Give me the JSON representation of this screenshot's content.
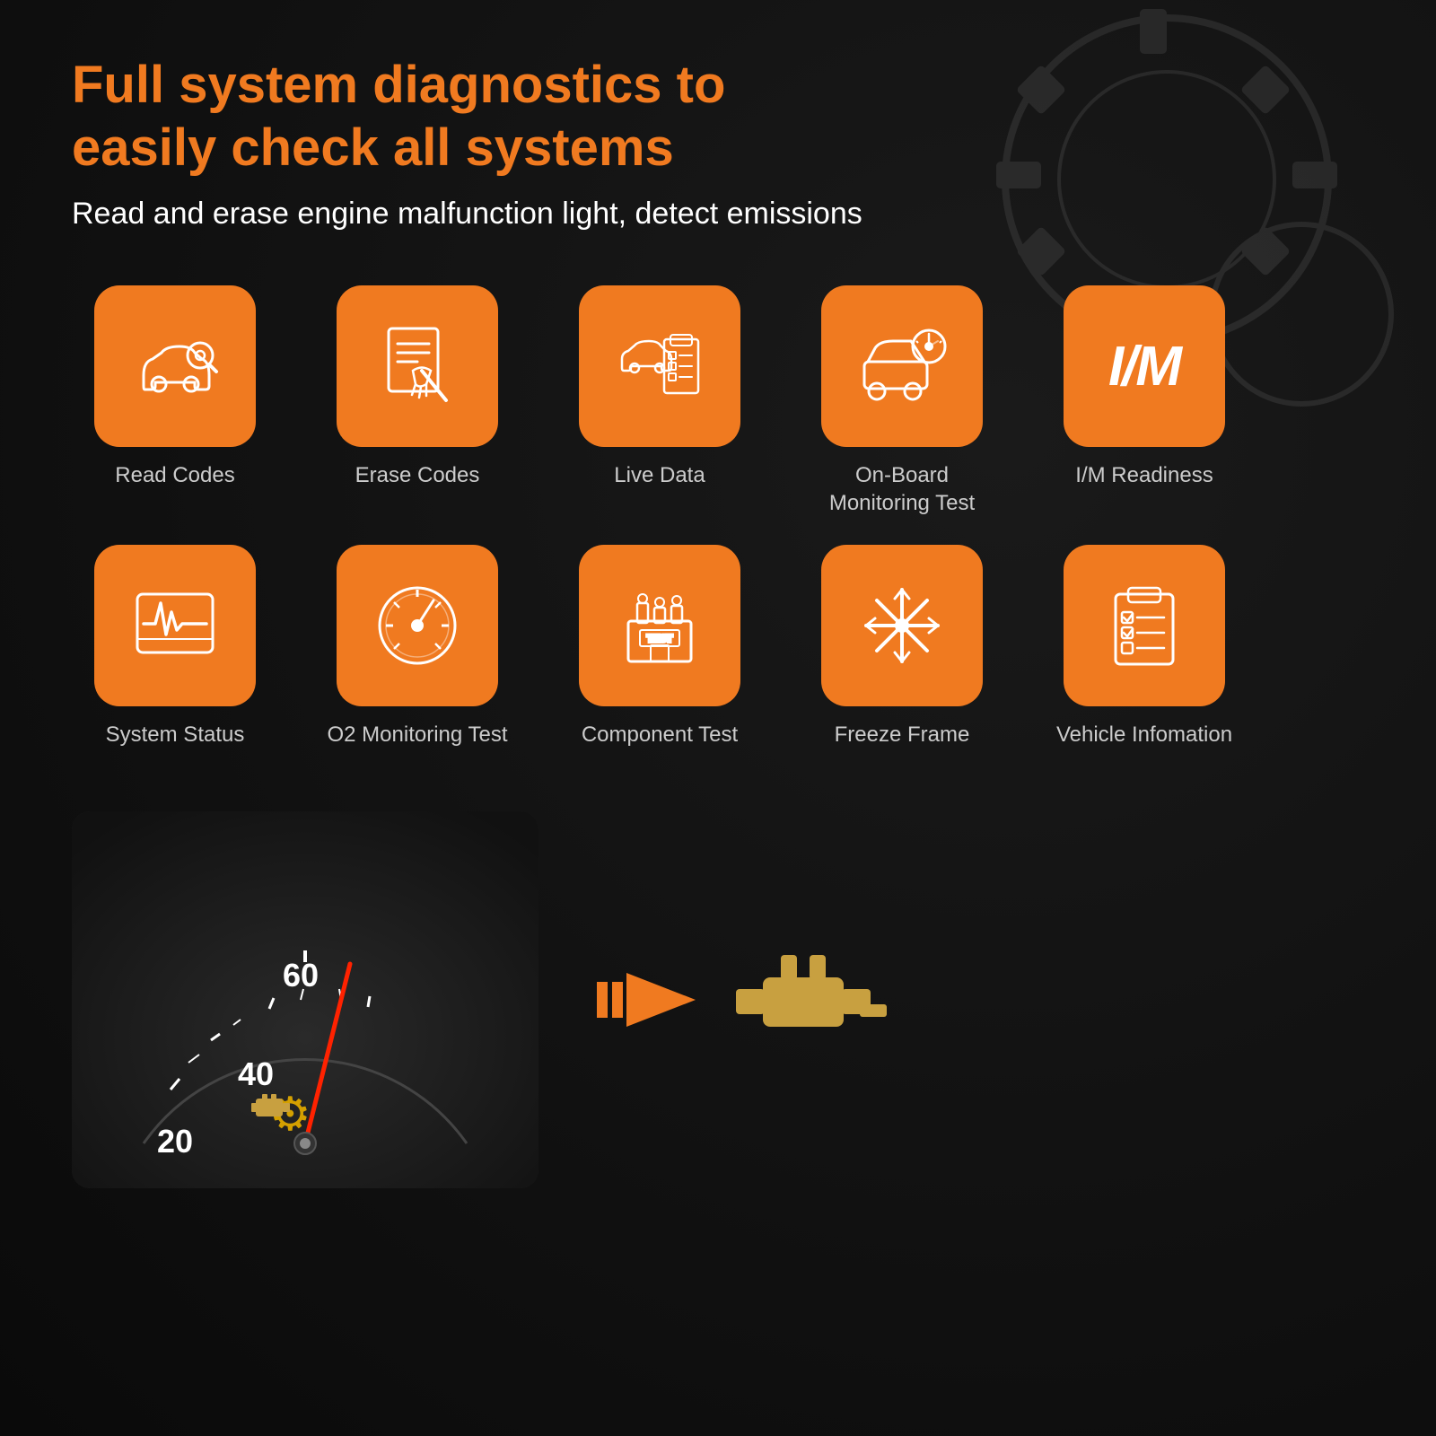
{
  "header": {
    "title": "Full system diagnostics to easily check all systems",
    "subtitle": "Read and erase engine malfunction light, detect emissions"
  },
  "features": {
    "row1": [
      {
        "id": "read-codes",
        "label": "Read Codes",
        "icon": "car-search"
      },
      {
        "id": "erase-codes",
        "label": "Erase Codes",
        "icon": "document-broom"
      },
      {
        "id": "live-data",
        "label": "Live Data",
        "icon": "car-list"
      },
      {
        "id": "onboard-monitoring",
        "label": "On-Board\nMonitoring Test",
        "icon": "car-gauge"
      },
      {
        "id": "im-readiness",
        "label": "I/M Readiness",
        "icon": "im-text"
      }
    ],
    "row2": [
      {
        "id": "system-status",
        "label": "System Status",
        "icon": "heartbeat"
      },
      {
        "id": "o2-monitoring",
        "label": "O2 Monitoring Test",
        "icon": "gauge"
      },
      {
        "id": "component-test",
        "label": "Component Test",
        "icon": "building-test"
      },
      {
        "id": "freeze-frame",
        "label": "Freeze Frame",
        "icon": "snowflake"
      },
      {
        "id": "vehicle-info",
        "label": "Vehicle Infomation",
        "icon": "clipboard"
      }
    ]
  },
  "colors": {
    "orange": "#f07a20",
    "white": "#ffffff",
    "dark_bg": "#111111",
    "label_color": "#cccccc"
  },
  "speedometer": {
    "values": [
      "20",
      "40",
      "60"
    ],
    "label": "speedometer display"
  },
  "bottom_arrow": {
    "direction": "right",
    "label": "arrow pointing right"
  }
}
